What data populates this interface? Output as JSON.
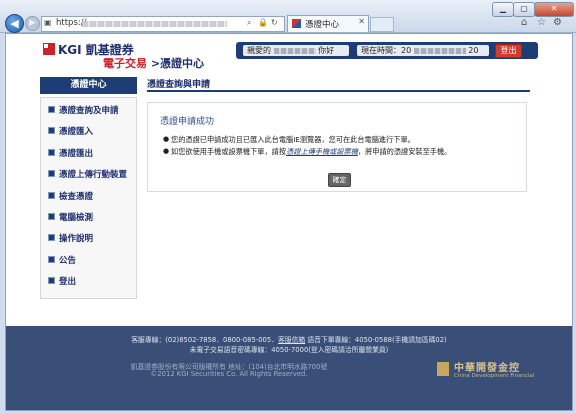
{
  "browser": {
    "address_prefix": "https://",
    "tab_title": "憑證中心",
    "window_buttons": {
      "minimize": "▁",
      "maximize": "▢",
      "close": "✕"
    }
  },
  "header": {
    "brand": "KGI 凱基證券",
    "site_title_main": "電子交易",
    "site_title_sub": ">憑證中心",
    "greeting_prefix": "親愛的",
    "greeting_suffix": "你好",
    "time_label": "現在時間：20",
    "time_tail": "20",
    "logout_label": "登出"
  },
  "sidebar": {
    "title": "憑證中心",
    "items": [
      {
        "label": "憑證查詢及申請"
      },
      {
        "label": "憑證匯入"
      },
      {
        "label": "憑證匯出"
      },
      {
        "label": "憑證上傳行動裝置"
      },
      {
        "label": "檢查憑證"
      },
      {
        "label": "電腦檢測"
      },
      {
        "label": "操作說明"
      },
      {
        "label": "公告"
      },
      {
        "label": "登出"
      }
    ]
  },
  "main": {
    "breadcrumb": "憑證查詢與申請",
    "panel_title": "憑證申請成功",
    "msg1": "您的憑證已申請成功且已匯入此台電腦IE瀏覽器，您可在此台電腦進行下單。",
    "msg2_before": "如您欲使用手機或設票機下單，請按",
    "msg2_link": "憑證上傳手機或設票機",
    "msg2_after": "，將申請的憑證安裝至手機。",
    "confirm_label": "確定"
  },
  "footer": {
    "line1_a": "客服專線：(02)8502-7858．0800-085-005．",
    "line1_link": "客服信箱",
    "line1_b": "  語音下單專線：4050-0588(手機請加區碼02)",
    "line2": "未電子交易語音密碼專線：4050-7000(登入密碼請洽所屬營業員)",
    "line3": "凱基證券股份有限公司版權所有  地址：(104)台北市明水路700號",
    "line4": "©2012 KGI Securities Co. All Rights Reserved.",
    "partner_name": "中華開發金控",
    "partner_en": "China Development Financial"
  },
  "colors": {
    "navy": "#1f3d75",
    "brand_red": "#cc2229",
    "footer_bg": "#3a4f78"
  }
}
